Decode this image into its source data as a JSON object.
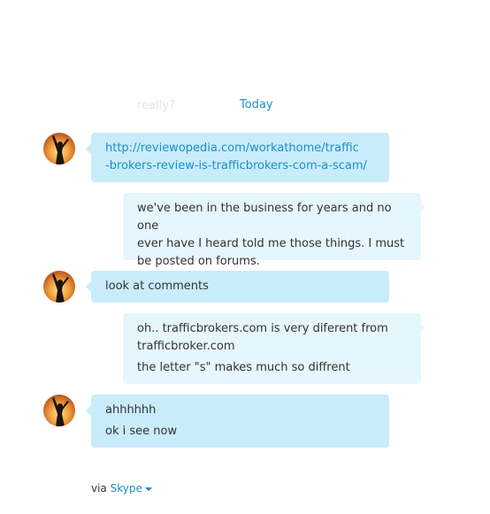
{
  "header": {
    "faded_text": "really?",
    "date_label": "Today"
  },
  "messages": [
    {
      "link_line1": "http://reviewopedia.com/workathome/traffic",
      "link_line2": "-brokers-review-is-trafficbrokers-com-a-scam/"
    },
    {
      "line1": "we've been in the business for years and no one",
      "line2": "ever have I heard told me those things. I must",
      "line3": "be posted on forums."
    },
    {
      "line1": "look at comments"
    },
    {
      "line1": "oh.. trafficbrokers.com is very diferent from",
      "line2": "trafficbroker.com",
      "line3": "the letter \"s\" makes much so diffrent"
    },
    {
      "line1": "ahhhhhh",
      "line2": "ok i see now"
    }
  ],
  "footer": {
    "via": "via",
    "service": "Skype"
  },
  "colors": {
    "accent": "#1a8fc9",
    "incoming_bubble": "#c9ecfb",
    "outgoing_bubble": "#e6f6fd"
  }
}
